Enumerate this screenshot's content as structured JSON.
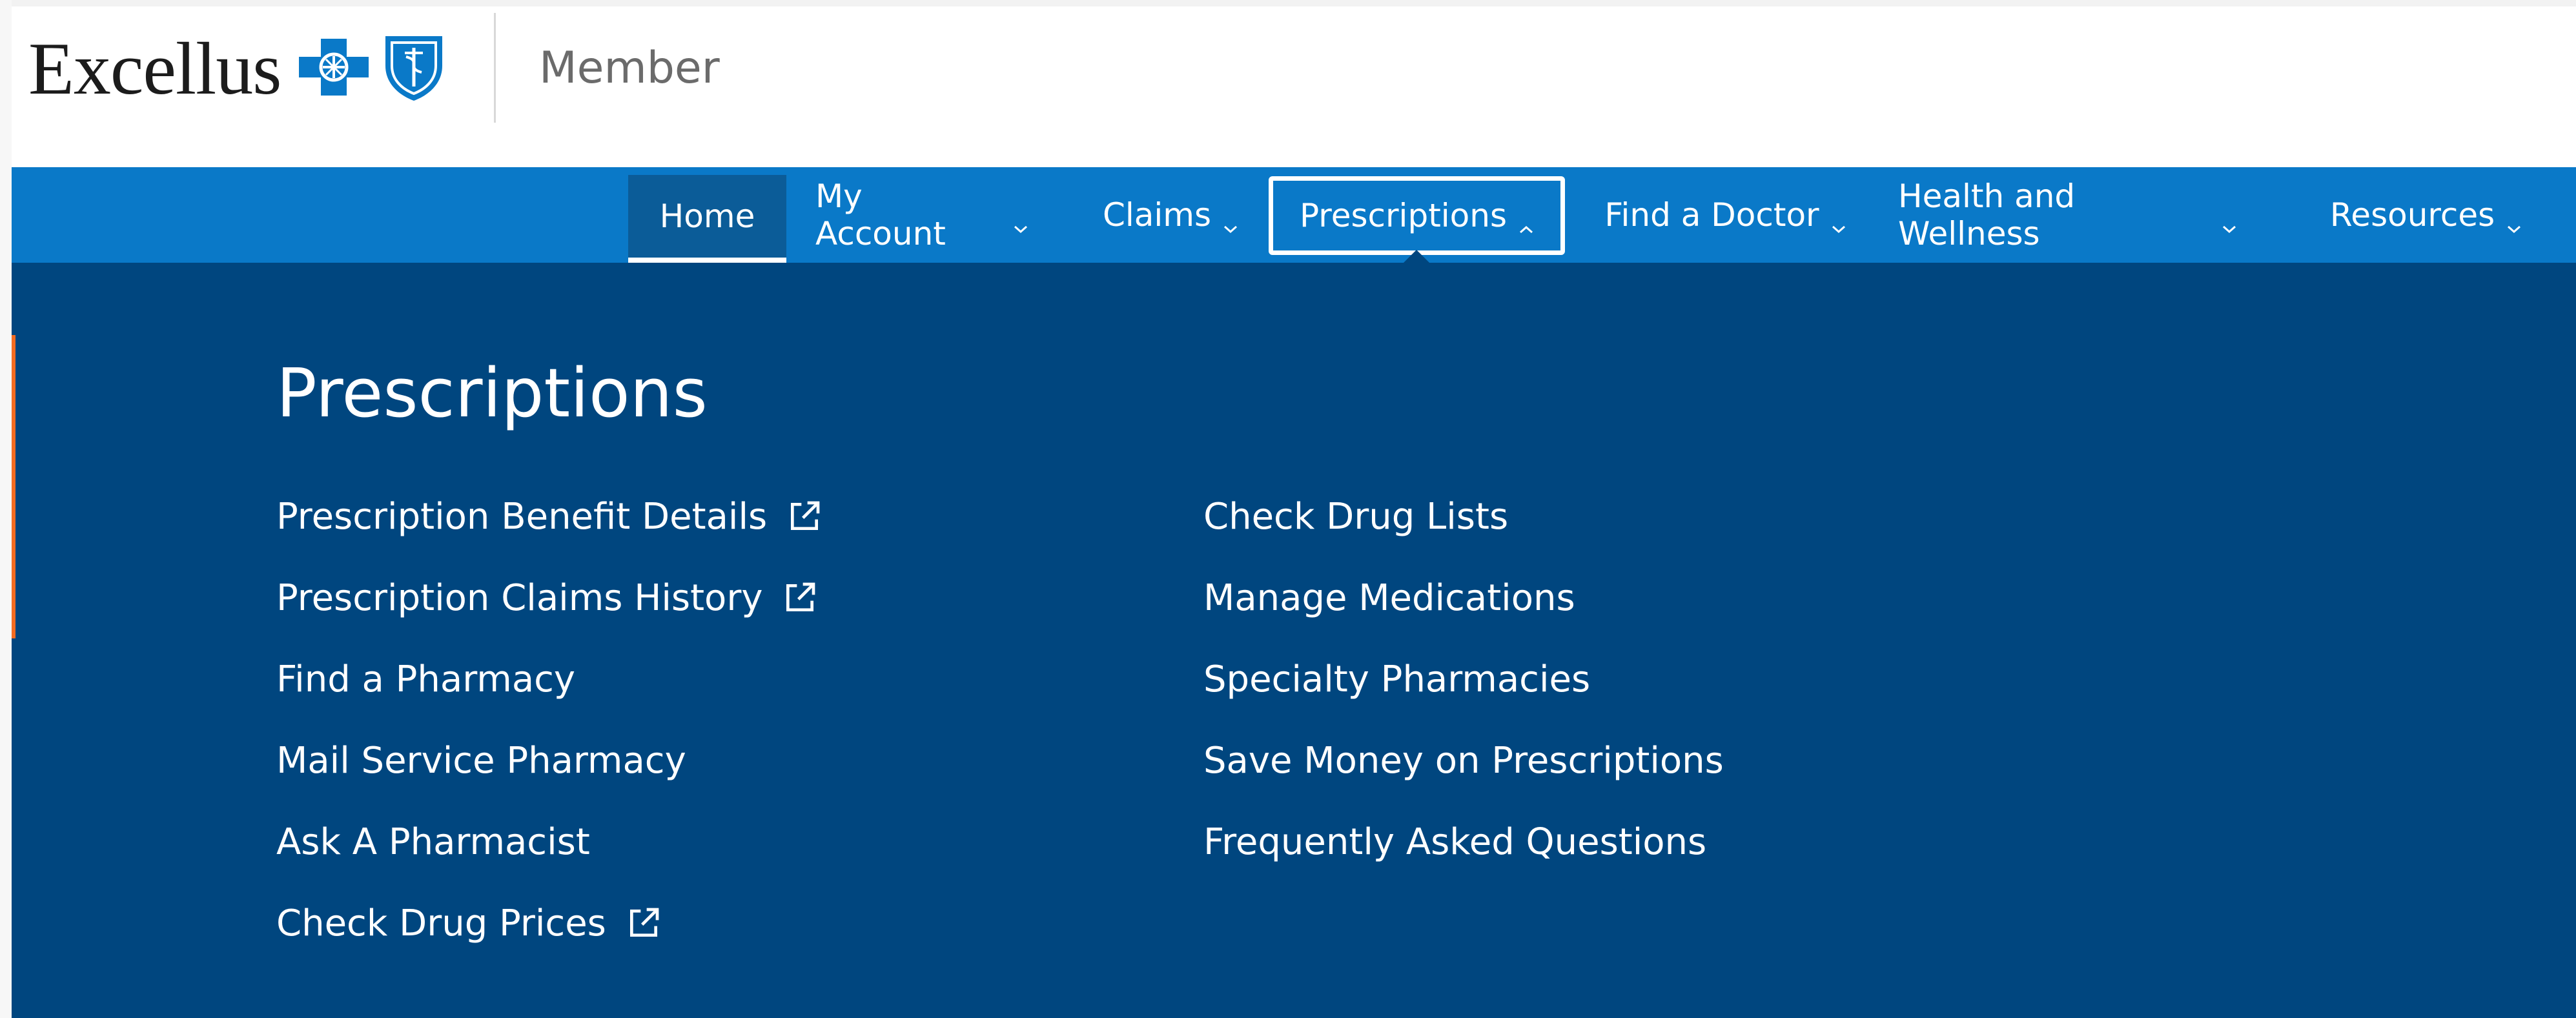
{
  "header": {
    "brand_name": "Excellus",
    "section_label": "Member"
  },
  "nav": {
    "items": [
      {
        "label": "Home",
        "has_chevron": false,
        "state": "current"
      },
      {
        "label": "My Account",
        "has_chevron": true,
        "state": "collapsed"
      },
      {
        "label": "Claims",
        "has_chevron": true,
        "state": "collapsed"
      },
      {
        "label": "Prescriptions",
        "has_chevron": true,
        "state": "expanded"
      },
      {
        "label": "Find a Doctor",
        "has_chevron": true,
        "state": "collapsed"
      },
      {
        "label": "Health and Wellness",
        "has_chevron": true,
        "state": "collapsed"
      },
      {
        "label": "Resources",
        "has_chevron": true,
        "state": "collapsed"
      }
    ]
  },
  "dropdown": {
    "title": "Prescriptions",
    "left_links": [
      {
        "label": "Prescription Benefit Details",
        "external": true
      },
      {
        "label": "Prescription Claims History",
        "external": true
      },
      {
        "label": "Find a Pharmacy",
        "external": false
      },
      {
        "label": "Mail Service Pharmacy",
        "external": false
      },
      {
        "label": "Ask A Pharmacist",
        "external": false
      },
      {
        "label": "Check Drug Prices",
        "external": true
      }
    ],
    "right_links": [
      {
        "label": "Check Drug Lists",
        "external": false
      },
      {
        "label": "Manage Medications",
        "external": false
      },
      {
        "label": "Specialty Pharmacies",
        "external": false
      },
      {
        "label": "Save Money on Prescriptions",
        "external": false
      },
      {
        "label": "Frequently Asked Questions",
        "external": false
      }
    ]
  },
  "colors": {
    "nav_blue": "#0a79c8",
    "panel_navy": "#00467f",
    "active_tab": "#0b5c98",
    "accent_orange": "#f36c21",
    "logo_blue": "#0a79c8"
  },
  "icons": {
    "logo_cross": "blue-cross-icon",
    "logo_shield": "blue-shield-icon",
    "chevron_down": "chevron-down-icon",
    "chevron_up": "chevron-up-icon",
    "external_link": "external-link-icon"
  }
}
